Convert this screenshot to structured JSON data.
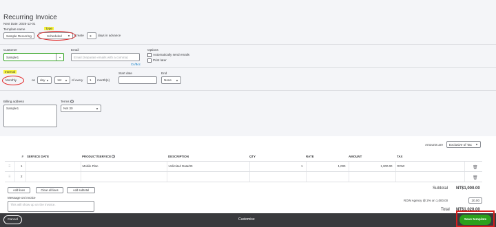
{
  "header": {
    "title": "Recurring Invoice",
    "next_date": "Next Date: 2025-12-01"
  },
  "template": {
    "name_label": "Template name",
    "name_value": "Sample Recurring",
    "type_label": "Type",
    "type_value": "Scheduled",
    "create_label": "Create",
    "create_value": "3",
    "days_text": "days in advance"
  },
  "customer": {
    "label": "Customer",
    "value": "Sample1",
    "email_label": "Email",
    "email_placeholder": "Email (Separate emails with a comma)",
    "cc_bcc": "Cc/Bcc",
    "options_label": "Options",
    "auto_send": "Automatically send emails",
    "print_later": "Print later"
  },
  "schedule": {
    "interval_label": "Interval",
    "interval_value": "Monthly",
    "on_text": "on",
    "day_value": "day",
    "nth_value": "1st",
    "of_every_text": "of every",
    "every_value": "1",
    "months_text": "month(s)",
    "start_label": "Start date",
    "start_value": "",
    "end_label": "End",
    "end_value": "None"
  },
  "billing": {
    "address_label": "Billing address",
    "address_value": "Sample1",
    "terms_label": "Terms",
    "terms_value": "Net 30"
  },
  "amounts": {
    "label": "Amounts are",
    "value": "Exclusive of Tax"
  },
  "table": {
    "headers": [
      "#",
      "SERVICE DATE",
      "PRODUCT/SERVICE",
      "DESCRIPTION",
      "QTY",
      "RATE",
      "AMOUNT",
      "TAX"
    ],
    "rows": [
      [
        "1",
        "",
        "Mobile Plan",
        "Unlimited Data/30",
        "1",
        "1,000",
        "1,000.00",
        "ROW"
      ],
      [
        "2",
        "",
        "",
        "",
        "",
        "",
        "",
        ""
      ]
    ]
  },
  "actions": {
    "add_lines": "Add lines",
    "clear_all": "Clear all lines",
    "add_subtotal": "Add subtotal"
  },
  "message": {
    "label": "Message on invoice",
    "placeholder": "This will show up on the invoice."
  },
  "totals": {
    "subtotal_label": "Subtotal",
    "subtotal_value": "NT$1,000.00",
    "tax_label": "ROW Agency @ 2% on 1,000.00",
    "tax_value": "20.00",
    "total_label": "Total",
    "total_value": "NT$1,020.00"
  },
  "footer": {
    "cancel": "Cancel",
    "customise": "Customise",
    "save": "Save template"
  },
  "colors": {
    "save_green": "#2ca01c",
    "footer_bg": "#393a3d",
    "highlight": "#f6f33c",
    "annotation_red": "#e11d1d"
  }
}
